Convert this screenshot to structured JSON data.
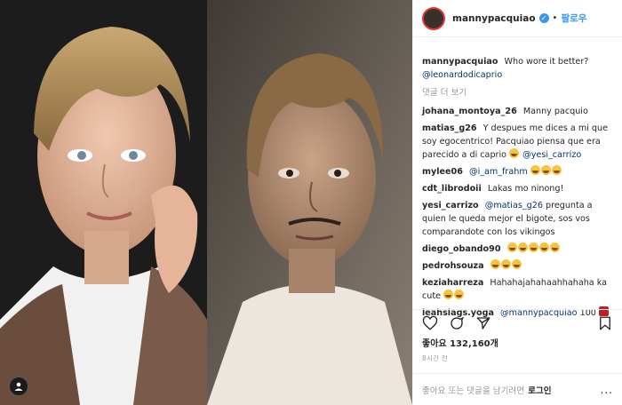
{
  "header": {
    "username": "mannypacquiao",
    "separator": "•",
    "follow_label": "팔로우"
  },
  "caption": {
    "username": "mannypacquiao",
    "text": "Who wore it better?",
    "mention": "@leonardodicaprio"
  },
  "more_comments": "댓글 더 보기",
  "comments": [
    {
      "user": "johana_montoya_26",
      "text": "Manny pacquio"
    },
    {
      "user": "matias_g26",
      "text": "Y despues me dices a mi que soy egocentrico! Pacquiao piensa que era parecido a di caprio",
      "mention": "@yesi_carrizo"
    },
    {
      "user": "mylee06",
      "mention": "@i_am_frahm"
    },
    {
      "user": "cdt_librodoii",
      "text": "Lakas mo ninong!"
    },
    {
      "user": "yesi_carrizo",
      "mention": "@matias_g26",
      "text": "pregunta a quien le queda mejor el bigote, sos vos comparandote con los vikingos"
    },
    {
      "user": "diego_obando90"
    },
    {
      "user": "pedrohsouza"
    },
    {
      "user": "keziaharreza",
      "text": "Hahahajahahaahhahaha ka cute"
    },
    {
      "user": "leahslags.yoga",
      "mention": "@mannypacquiao",
      "text": "100"
    }
  ],
  "likes": "좋아요 132,160개",
  "timestamp": "8시간 전",
  "login_prompt": {
    "text": "좋아요 또는 댓글을 남기려면",
    "link": "로그인",
    "menu": "..."
  },
  "colors": {
    "accent": "#3897f0",
    "text": "#262626",
    "muted": "#999999"
  }
}
